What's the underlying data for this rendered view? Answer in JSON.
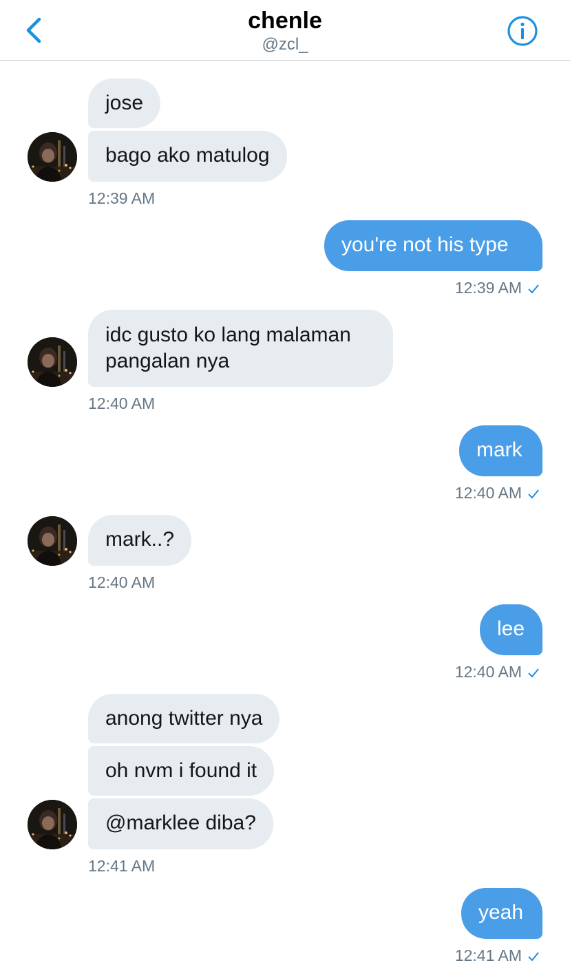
{
  "header": {
    "name": "chenle",
    "handle": "@zcl_"
  },
  "messages": {
    "m1": "jose",
    "m2": "bago ako matulog",
    "t1": "12:39 AM",
    "m3": "you're not his type",
    "t2": "12:39 AM",
    "m4": "idc gusto ko lang malaman pangalan nya",
    "t3": "12:40 AM",
    "m5": "mark",
    "t4": "12:40 AM",
    "m6": "mark..?",
    "t5": "12:40 AM",
    "m7": "lee",
    "t6": "12:40 AM",
    "m8": "anong twitter nya",
    "m9": "oh nvm i found it",
    "m10": "@marklee diba?",
    "t7": "12:41 AM",
    "m11": "yeah",
    "t8": "12:41 AM"
  },
  "colors": {
    "accent": "#1da1f2",
    "outgoing_bubble": "#4a9ee8",
    "incoming_bubble": "#e6ecf0",
    "meta_text": "#657786"
  },
  "icons": {
    "back": "chevron-left-icon",
    "info": "info-icon",
    "read": "checkmark-icon"
  }
}
